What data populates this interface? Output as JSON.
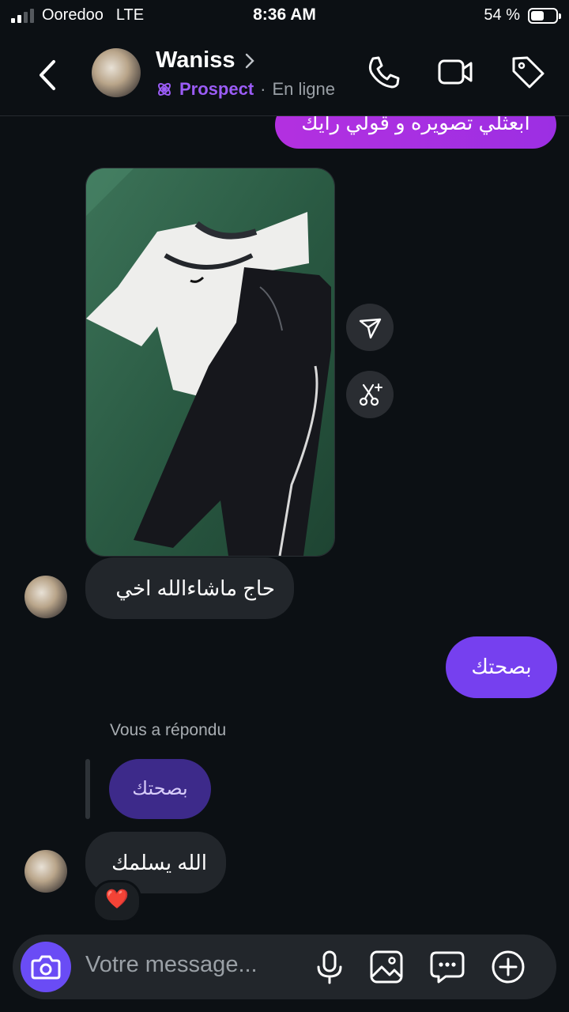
{
  "status": {
    "carrier": "Ooredoo",
    "network": "LTE",
    "time": "8:36 AM",
    "battery": "54 %",
    "battery_level": 0.54,
    "signal_bars": 2
  },
  "header": {
    "name": "Waniss",
    "label": "Prospect",
    "separator": "·",
    "presence": "En ligne"
  },
  "messages": {
    "outgoing_top": "ابعثلي تصويره و قولي رايك",
    "incoming_1": "حاج ماشاءالله اخي",
    "outgoing_2": "بصحتك",
    "reply_label": "Vous a répondu",
    "reply_quote": "بصحتك",
    "incoming_2": "الله يسلمك",
    "reaction": "❤️"
  },
  "composer": {
    "placeholder": "Votre message..."
  },
  "colors": {
    "background": "#0c1014",
    "accent_purple": "#7640ef",
    "prospect_tag": "#9b5cf6",
    "pink_bubble": "#b330e0"
  }
}
